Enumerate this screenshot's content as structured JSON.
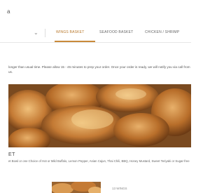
{
  "header": {
    "search_glyph": "a",
    "search_icon": "search-icon"
  },
  "nav": {
    "dropdown_icon": "chevron-down-icon",
    "tabs": [
      {
        "label": "WINGS BASKET",
        "active": true
      },
      {
        "label": "SEAFOOD BASKET",
        "active": false
      },
      {
        "label": "CHICKEN / SHRIMP",
        "active": false
      }
    ],
    "accent_color": "#c98a3a"
  },
  "notice": {
    "text": "longer than usual time. Please allow 15 - 45 minutes to prep your order. Once your order is ready, we will notify you via call from us."
  },
  "section": {
    "title": "ET",
    "description": "et Bowl or one Choice of Hot or Mild Buffalo, Lemon Pepper, Asian Cajun, Thai Chili, BBQ, Honey Mustard, Sweet Teriyaki or Sugar-free"
  },
  "card": {
    "label": "13 WINGS"
  }
}
